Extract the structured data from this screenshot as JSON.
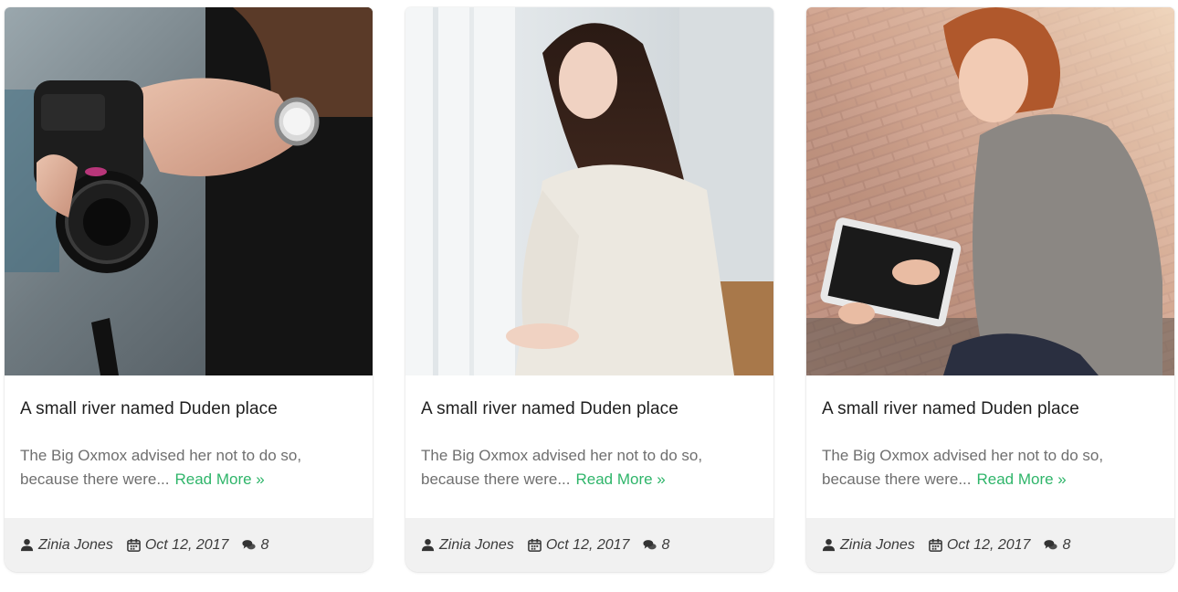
{
  "cards": [
    {
      "title": "A small river named Duden place",
      "excerpt": "The Big Oxmox advised her not to do so, because there were...",
      "read_more": "Read More »",
      "author": "Zinia Jones",
      "date": "Oct 12, 2017",
      "comments": "8",
      "image": "photo of hands holding a camera"
    },
    {
      "title": "A small river named Duden place",
      "excerpt": "The Big Oxmox advised her not to do so, because there were...",
      "read_more": "Read More »",
      "author": "Zinia Jones",
      "date": "Oct 12, 2017",
      "comments": "8",
      "image": "photo of woman in white sweater by curtain"
    },
    {
      "title": "A small river named Duden place",
      "excerpt": "The Big Oxmox advised her not to do so, because there were...",
      "read_more": "Read More »",
      "author": "Zinia Jones",
      "date": "Oct 12, 2017",
      "comments": "8",
      "image": "photo of woman using a tablet outdoors"
    }
  ],
  "colors": {
    "accent": "#2fb56a",
    "title": "#1e1e1e",
    "text": "#6f6f6f",
    "footer_bg": "#f1f1f1"
  },
  "icons": {
    "author": "user-icon",
    "date": "calendar-icon",
    "comments": "comments-icon",
    "read_more": "double-chevron-right-icon"
  }
}
